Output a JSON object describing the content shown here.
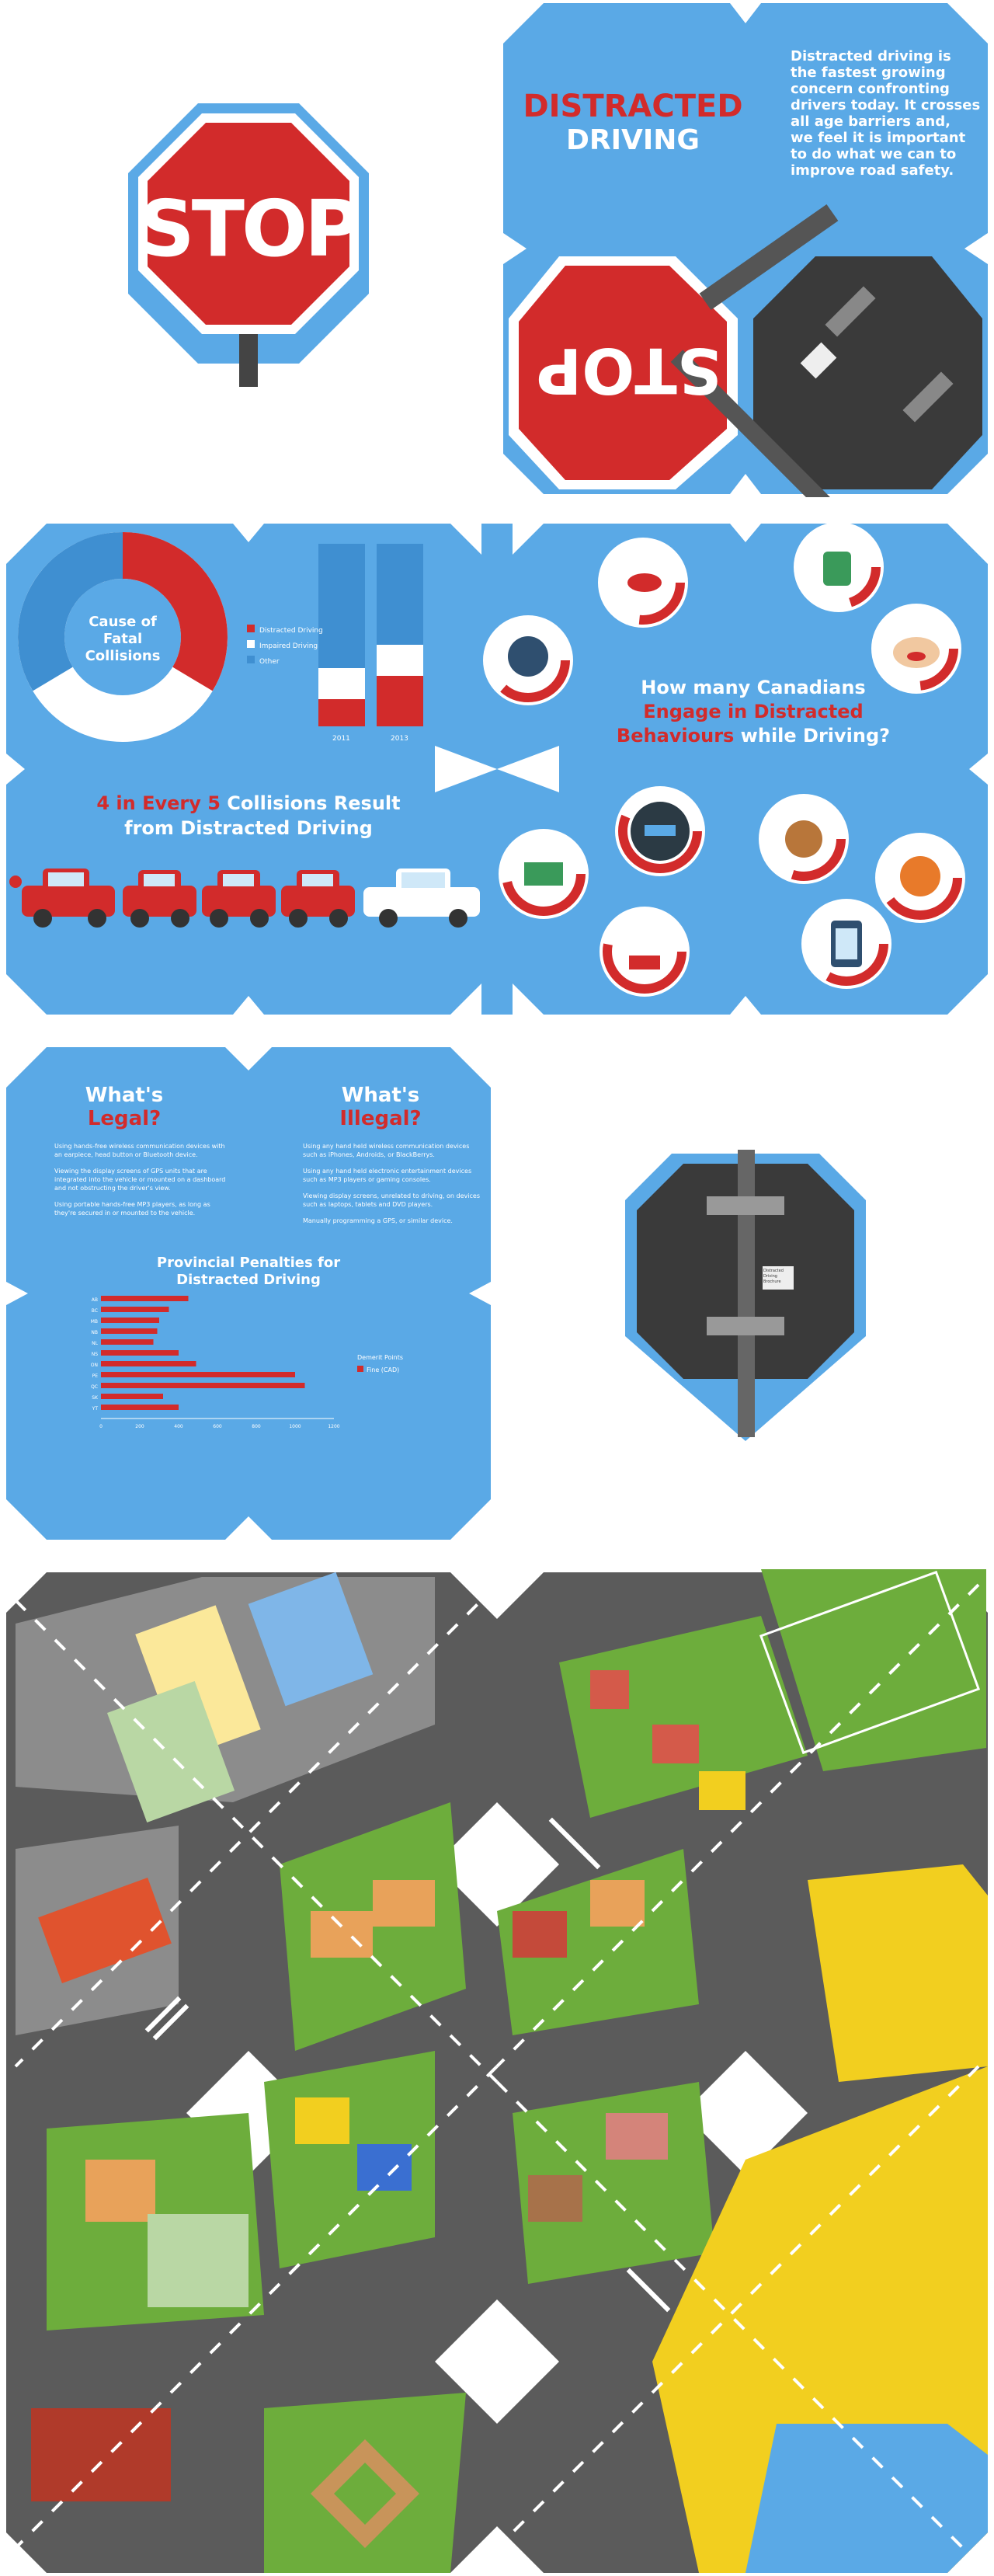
{
  "colors": {
    "sky": "#5aa9e6",
    "skyDark": "#3f8fd1",
    "red": "#d22b2b",
    "white": "#ffffff",
    "dark": "#3a3a3a",
    "road": "#5b5b5b",
    "grass": "#6dad3c",
    "yellow": "#f2cf1f",
    "mapGrey": "#8c8c8c"
  },
  "stop_sign": {
    "text": "STOP",
    "text_flipped": "STOP"
  },
  "cover": {
    "title_line1": "DISTRACTED",
    "title_line2": "DRIVING",
    "intro": [
      "Distracted driving is",
      "the fastest growing",
      "concern confronting",
      "drivers today. It crosses",
      "all age barriers and,",
      "we feel it is important",
      "to do what we can to",
      "improve road safety."
    ],
    "tag_text": [
      "Distracted",
      "Driving",
      "Brochure"
    ]
  },
  "causes": {
    "donut_label": [
      "Cause of",
      "Fatal",
      "Collisions"
    ],
    "legend": [
      "Distracted Driving",
      "Impaired Driving",
      "Other"
    ],
    "bar_years": [
      "2011",
      "2013"
    ]
  },
  "collisions": {
    "headline_pre": "4 in Every ",
    "headline_num": "5",
    "headline_post": " Collisions Result",
    "headline_line2": "from Distracted Driving"
  },
  "behaviours": {
    "line1": "How many Canadians",
    "line2": "Engage in Distracted",
    "line3_red": "Behaviours",
    "line3_rest": " while Driving?"
  },
  "legal": {
    "title_legal_l1": "What's",
    "title_legal_l2": "Legal?",
    "title_illegal_l1": "What's",
    "title_illegal_l2": "Illegal?",
    "legal_items": [
      "Using hands-free wireless communication devices with an earpiece, head button or Bluetooth device.",
      "Viewing the display screens of GPS units that are integrated into the vehicle or mounted on a dashboard and not obstructing the driver's view.",
      "Using portable hands-free MP3 players, as long as they're secured in or mounted to the vehicle."
    ],
    "illegal_items": [
      "Using any hand held wireless communication devices such as iPhones, Androids, or BlackBerrys.",
      "Using any hand held electronic entertainment devices such as MP3 players or gaming consoles.",
      "Viewing display screens, unrelated to driving, on devices such as laptops, tablets and DVD players.",
      "Manually programming a GPS, or similar device."
    ],
    "penalties_title_l1": "Provincial Penalties for",
    "penalties_title_l2": "Distracted Driving",
    "legend": [
      "Demerit Points",
      "Fine (CAD)"
    ]
  },
  "back_tag": {
    "lines": [
      "Distracted",
      "Driving",
      "Brochure"
    ]
  },
  "chart_data": [
    {
      "type": "pie",
      "title": "Cause of Fatal Collisions",
      "categories": [
        "Distracted Driving",
        "Impaired Driving",
        "Other"
      ],
      "values": [
        30,
        35,
        35
      ]
    },
    {
      "type": "bar",
      "categories": [
        "2011",
        "2013"
      ],
      "series": [
        {
          "name": "Other",
          "values": [
            70,
            55
          ]
        },
        {
          "name": "Impaired Driving",
          "values": [
            18,
            20
          ]
        },
        {
          "name": "Distracted Driving",
          "values": [
            12,
            25
          ]
        }
      ]
    },
    {
      "type": "bar",
      "title": "Provincial Penalties for Distracted Driving",
      "categories": [
        "AB",
        "BC",
        "MB",
        "NB",
        "NL",
        "NS",
        "ON",
        "PE",
        "QC",
        "SK",
        "YT"
      ],
      "series": [
        {
          "name": "Fine (CAD)",
          "values": [
            450,
            350,
            300,
            290,
            270,
            400,
            490,
            1000,
            1050,
            320,
            400
          ]
        }
      ],
      "xlim": [
        0,
        1200
      ],
      "xticks": [
        "0",
        "200",
        "400",
        "600",
        "800",
        "1000",
        "1200"
      ]
    }
  ]
}
